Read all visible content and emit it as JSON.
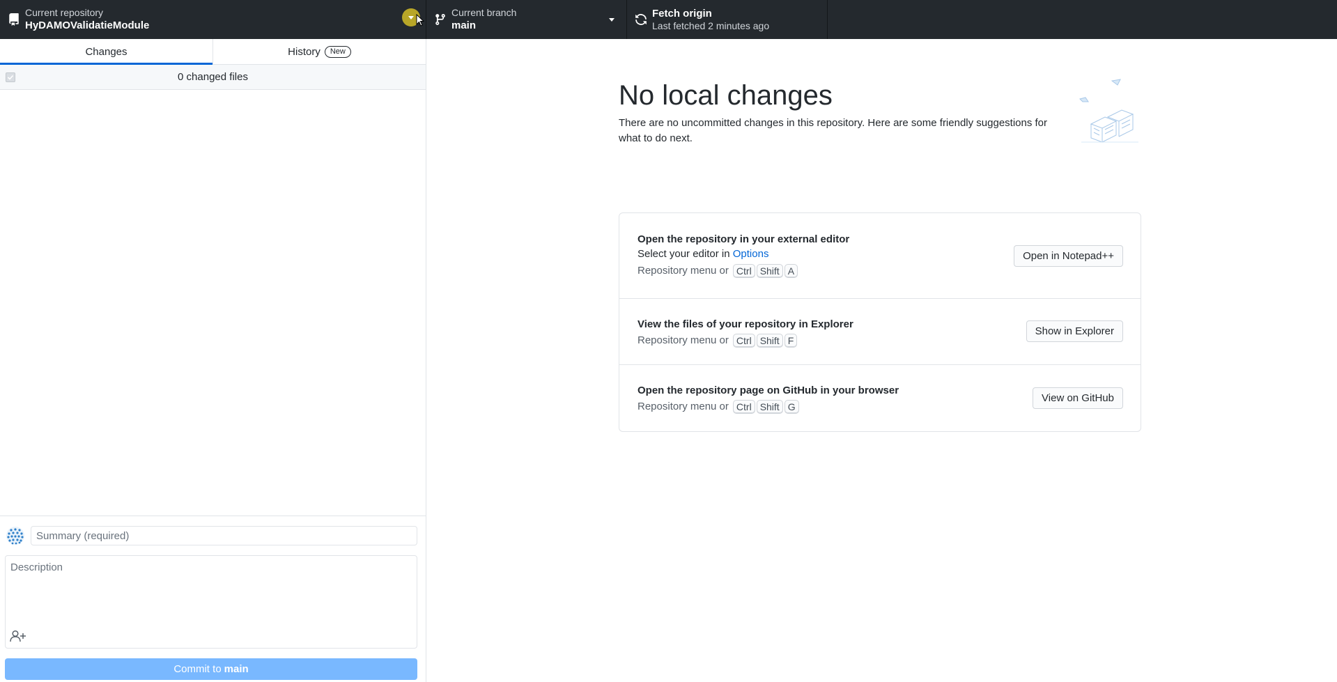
{
  "toolbar": {
    "repository": {
      "label": "Current repository",
      "value": "HyDAMOValidatieModule"
    },
    "branch": {
      "label": "Current branch",
      "value": "main"
    },
    "fetch": {
      "title": "Fetch origin",
      "subtitle": "Last fetched 2 minutes ago"
    }
  },
  "sidebar": {
    "tabs": [
      {
        "label": "Changes",
        "active": true
      },
      {
        "label": "History",
        "badge": "New",
        "active": false
      }
    ],
    "changes_count": "0 changed files",
    "commit": {
      "summary_placeholder": "Summary (required)",
      "description_placeholder": "Description",
      "button_prefix": "Commit to",
      "button_branch": "main"
    }
  },
  "main": {
    "title": "No local changes",
    "subtitle": "There are no uncommitted changes in this repository. Here are some friendly suggestions for what to do next.",
    "actions": [
      {
        "title": "Open the repository in your external editor",
        "desc_prefix": "Select your editor in",
        "desc_link": "Options",
        "shortcut_prefix": "Repository menu or",
        "keys": [
          "Ctrl",
          "Shift",
          "A"
        ],
        "button": "Open in Notepad++"
      },
      {
        "title": "View the files of your repository in Explorer",
        "shortcut_prefix": "Repository menu or",
        "keys": [
          "Ctrl",
          "Shift",
          "F"
        ],
        "button": "Show in Explorer"
      },
      {
        "title": "Open the repository page on GitHub in your browser",
        "shortcut_prefix": "Repository menu or",
        "keys": [
          "Ctrl",
          "Shift",
          "G"
        ],
        "button": "View on GitHub"
      }
    ]
  },
  "colors": {
    "toolbar_bg": "#24292e",
    "accent": "#0366d6",
    "commit_button_disabled": "#79b8ff",
    "hover_highlight": "#b8a628"
  },
  "icons": {
    "repository": "repo-icon",
    "branch": "git-branch-icon",
    "fetch": "sync-icon",
    "caret": "triangle-down-icon",
    "coauthor": "person-add-icon"
  }
}
